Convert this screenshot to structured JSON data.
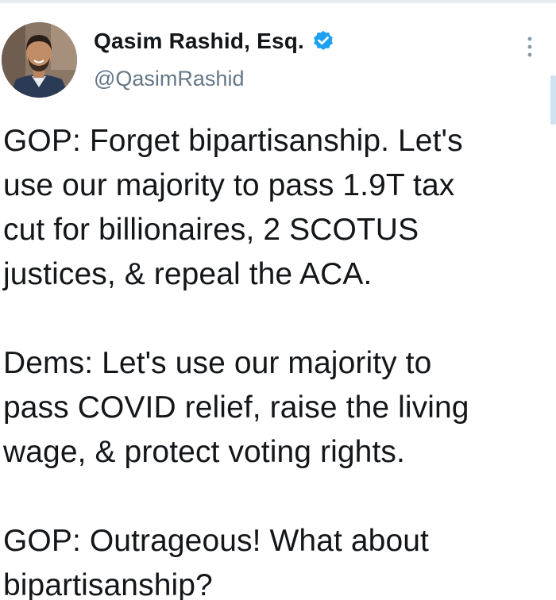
{
  "tweet": {
    "author": {
      "display_name": "Qasim Rashid, Esq.",
      "handle": "@QasimRashid",
      "verified": true,
      "avatar_icon": "user-avatar-photo"
    },
    "more_icon": "more-vertical-icon",
    "paragraphs": [
      "GOP: Forget bipartisanship. Let's\nuse our majority to pass 1.9T tax\ncut for billionaires, 2 SCOTUS\njustices, & repeal the ACA.",
      "Dems: Let's use our majority to\npass COVID relief, raise the living\nwage, & protect voting rights.",
      "GOP: Outrageous! What about\nbipartisanship?"
    ]
  },
  "colors": {
    "verified_blue": "#1DA1F2",
    "handle_gray": "#657786",
    "text": "#14171A",
    "scroll_accent": "#CFE3F3"
  }
}
